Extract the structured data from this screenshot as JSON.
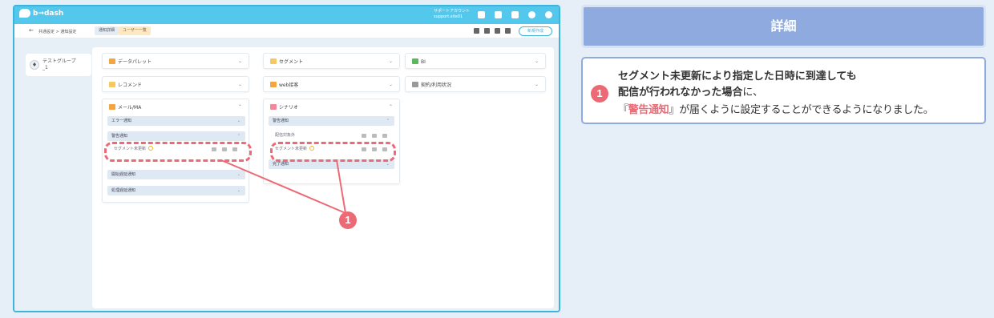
{
  "app": {
    "logo": "b→dash"
  },
  "topbar": {
    "support_line1": "サポートアカウント",
    "support_line2": "support.site01"
  },
  "breadcrumb": {
    "text": "共通設定 > 通知設定"
  },
  "tabs": [
    {
      "label": "通知詳細"
    },
    {
      "label": "ユーザー一覧"
    }
  ],
  "toolbar": {
    "new_label": "新規作成"
  },
  "sidebar": {
    "group_label": "テストグループ_1"
  },
  "panels": {
    "datapallet": "データパレット",
    "segment": "セグメント",
    "bi": "BI",
    "recommend": "レコメンド",
    "web": "web接客",
    "contract": "契約/利用状況",
    "mail": "メール/MA",
    "scenario": "シナリオ"
  },
  "mail_rows": {
    "error": "エラー通知",
    "warning": "警告通知",
    "segment_unupdated": "セグメント未更新",
    "start_delay": "開始遅延通知",
    "delivery_delay": "処理遅延通知"
  },
  "scenario_rows": {
    "warning": "警告通知",
    "excluded": "配信対象外",
    "segment_unupdated": "セグメント未更新",
    "complete": "完了通知"
  },
  "annotation": {
    "number": "1"
  },
  "detail": {
    "header": "詳細",
    "line1": "セグメント未更新により指定した日時に到達しても",
    "line2_bold": "配信が行われなかった場合",
    "line2_rest": "に、",
    "line3_open": "『",
    "line3_emph": "警告通知",
    "line3_rest": "』が届くように設定することができるようになりました。"
  },
  "colors": {
    "accent": "#54c8ec",
    "annotation": "#ec6a76",
    "header": "#8eaadf"
  }
}
